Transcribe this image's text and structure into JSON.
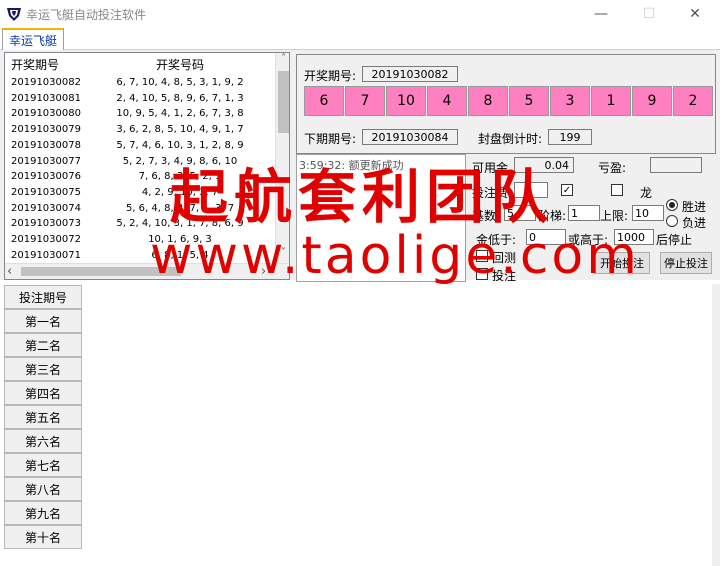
{
  "window": {
    "title": "幸运飞艇自动投注软件",
    "minimize": "—",
    "maximize": "☐",
    "close": "✕"
  },
  "tabs": [
    {
      "label": "幸运飞艇"
    }
  ],
  "grid": {
    "headers": [
      "开奖期号",
      "开奖号码"
    ],
    "rows": [
      [
        "20191030082",
        "6, 7, 10, 4, 8, 5, 3, 1, 9, 2"
      ],
      [
        "20191030081",
        "2, 4, 10, 5, 8, 9, 6, 7, 1, 3"
      ],
      [
        "20191030080",
        "10, 9, 5, 4, 1, 2, 6, 7, 3, 8"
      ],
      [
        "20191030079",
        "3, 6, 2, 8, 5, 10, 4, 9, 1, 7"
      ],
      [
        "20191030078",
        "5, 7, 4, 6, 10, 3, 1, 2, 8, 9"
      ],
      [
        "20191030077",
        "5, 2, 7, 3, 4, 9, 8, 6, 10"
      ],
      [
        "20191030076",
        "7, 6, 8, 3, 5, 2, 1"
      ],
      [
        "20191030075",
        "4, 2, 9, 10, 3, 7"
      ],
      [
        "20191030074",
        "5, 6, 4, 8, 2, 7, 1, 3, 7"
      ],
      [
        "20191030073",
        "5, 2, 4, 10, 3, 1, 7, 8, 6, 9"
      ],
      [
        "20191030072",
        "10, 1, 6, 9, 3"
      ],
      [
        "20191030071",
        "6, 8, 1, 5, 4"
      ]
    ],
    "scroll_left": "‹",
    "scroll_right": "›",
    "scroll_up": "˄",
    "scroll_down": "˅"
  },
  "draw": {
    "current_label": "开奖期号:",
    "current_issue": "20191030082",
    "balls": [
      "6",
      "7",
      "10",
      "4",
      "8",
      "5",
      "3",
      "1",
      "9",
      "2"
    ],
    "next_label": "下期期号:",
    "next_issue": "20191030084",
    "countdown_label": "封盘倒计时:",
    "countdown": "199"
  },
  "log": {
    "line1": "3:59:32: 额更新成功"
  },
  "controls": {
    "balance_label": "可用金",
    "balance_value": "0.04",
    "profit_label": "亏盈:",
    "bet_label": "投注费",
    "dragon_label": "龙",
    "base_label": "基数:",
    "base_value": "5",
    "step_label": "阶梯:",
    "step_value": "1",
    "limit_label": "上限:",
    "limit_value": "10",
    "radio_win": "胜进",
    "radio_lose": "负进",
    "low_label": "金低于:",
    "low_value": "0",
    "high_label": "或高于:",
    "high_value": "1000",
    "stop_label": "后停止",
    "check1_label": "回测",
    "check2_label": "投注",
    "start_button": "开始投注",
    "stop_button": "停止投注"
  },
  "bet_table": {
    "rows": [
      "投注期号",
      "第一名",
      "第二名",
      "第三名",
      "第四名",
      "第五名",
      "第六名",
      "第七名",
      "第八名",
      "第九名",
      "第十名"
    ]
  },
  "watermark": {
    "line1": "起航套利团队",
    "line2": "www.taolige.com"
  },
  "colors": {
    "ball": "#ff80c0",
    "watermark": "#e00000",
    "tab_accent": "#f5b400"
  }
}
